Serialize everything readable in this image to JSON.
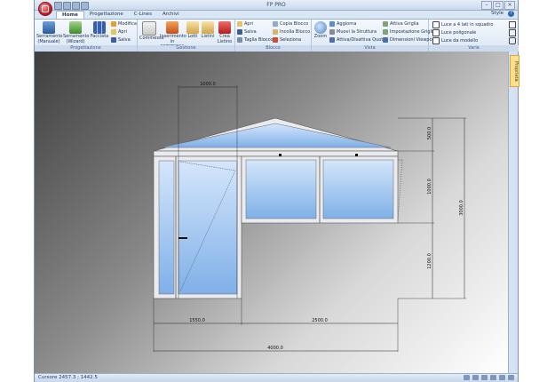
{
  "window": {
    "title": "FP PRO"
  },
  "tabs": [
    {
      "label": "Home"
    },
    {
      "label": "Progettazione"
    },
    {
      "label": "C-Lines"
    },
    {
      "label": "Archivi"
    }
  ],
  "style_label": "Style",
  "help_label": "?",
  "ribbon": {
    "progettazione": {
      "label": "Progettazione",
      "buttons": [
        {
          "label": "Serramento (Manuale)",
          "icon": "window-manual-icon"
        },
        {
          "label": "Serramento (Wizard)",
          "icon": "window-wizard-icon"
        },
        {
          "label": "Facciata",
          "icon": "facade-icon"
        }
      ],
      "small": [
        {
          "label": "Modifica",
          "icon": "edit-icon"
        },
        {
          "label": "Apri",
          "icon": "open-icon"
        },
        {
          "label": "Salva",
          "icon": "save-icon"
        }
      ]
    },
    "gestione": {
      "label": "Gestione",
      "buttons": [
        {
          "label": "Commesse",
          "icon": "orders-icon"
        },
        {
          "label": "Inserimento in commessa",
          "icon": "insert-order-icon"
        },
        {
          "label": "Lotti",
          "icon": "lots-icon"
        },
        {
          "label": "Listini",
          "icon": "price-lists-icon"
        },
        {
          "label": "Crea Listino",
          "icon": "create-price-list-icon"
        }
      ]
    },
    "blocco": {
      "label": "Blocco",
      "small": [
        {
          "label": "Apri",
          "icon": "open-block-icon"
        },
        {
          "label": "Salva",
          "icon": "save-block-icon"
        },
        {
          "label": "Taglia Blocco",
          "icon": "cut-block-icon"
        },
        {
          "label": "Copia Blocco",
          "icon": "copy-block-icon"
        },
        {
          "label": "Incolla Blocco",
          "icon": "paste-block-icon"
        },
        {
          "label": "Seleziona",
          "icon": "select-icon"
        }
      ]
    },
    "vista": {
      "label": "Vista",
      "zoom_label": "Zoom",
      "small": [
        {
          "label": "Aggiorna",
          "icon": "refresh-icon"
        },
        {
          "label": "Muovi la Struttura",
          "icon": "move-structure-icon"
        },
        {
          "label": "Attiva/Disattiva Quote",
          "icon": "toggle-dimensions-icon"
        },
        {
          "label": "Attiva Griglia",
          "icon": "grid-on-icon"
        },
        {
          "label": "Impostazione Griglia",
          "icon": "grid-settings-icon"
        },
        {
          "label": "Dimensioni Viewport",
          "icon": "viewport-size-icon"
        }
      ]
    },
    "varie": {
      "label": "Varie",
      "small": [
        {
          "label": "Luce a 4 lati in squadro",
          "icon": "square-light-icon"
        },
        {
          "label": "Luce poligonale",
          "icon": "polygon-light-icon"
        },
        {
          "label": "Luce da modello",
          "icon": "model-light-icon"
        }
      ]
    }
  },
  "properties_tab": "Proprietà",
  "drawing": {
    "dimensions": {
      "top_width": "1000.0",
      "right_top": "500.0",
      "right_middle": "1000.0",
      "right_bottom": "1200.0",
      "right_total": "3000.0",
      "bottom_left": "1550.0",
      "bottom_right": "2500.0",
      "bottom_total": "4000.0"
    }
  },
  "status": {
    "cursor": "Cursore 2457.3 ; 1442.5"
  },
  "colors": {
    "accent": "#2f67b6",
    "glass": "#a9cbf0",
    "frame": "#e9ebee"
  }
}
